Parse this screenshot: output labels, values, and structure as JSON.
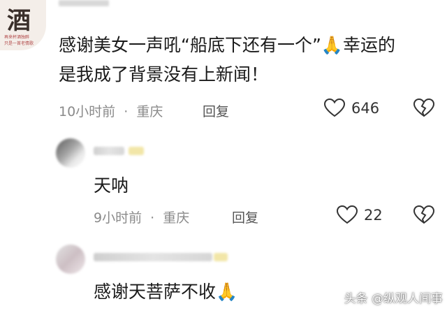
{
  "comments": [
    {
      "avatar_text": "酒",
      "avatar_caption_1": "再来杯酒独醉",
      "avatar_caption_2": "只是一首老情歌",
      "text": "感谢美女一声吼“船底下还有一个”🙏幸运的是我成了背景没有上新闻！",
      "time": "10小时前",
      "location": "重庆",
      "reply_label": "回复",
      "likes": "646"
    },
    {
      "text": "天呐",
      "time": "9小时前",
      "location": "重庆",
      "reply_label": "回复",
      "likes": "22"
    },
    {
      "text": "感谢天菩萨不收🙏"
    }
  ],
  "separator": "·",
  "watermark": "头条 @纵观人间事",
  "icons": {
    "like": "heart-outline-icon",
    "dislike": "broken-heart-icon"
  },
  "colors": {
    "text": "#1a1a1a",
    "meta": "#8a8a8a",
    "icon": "#333333"
  }
}
